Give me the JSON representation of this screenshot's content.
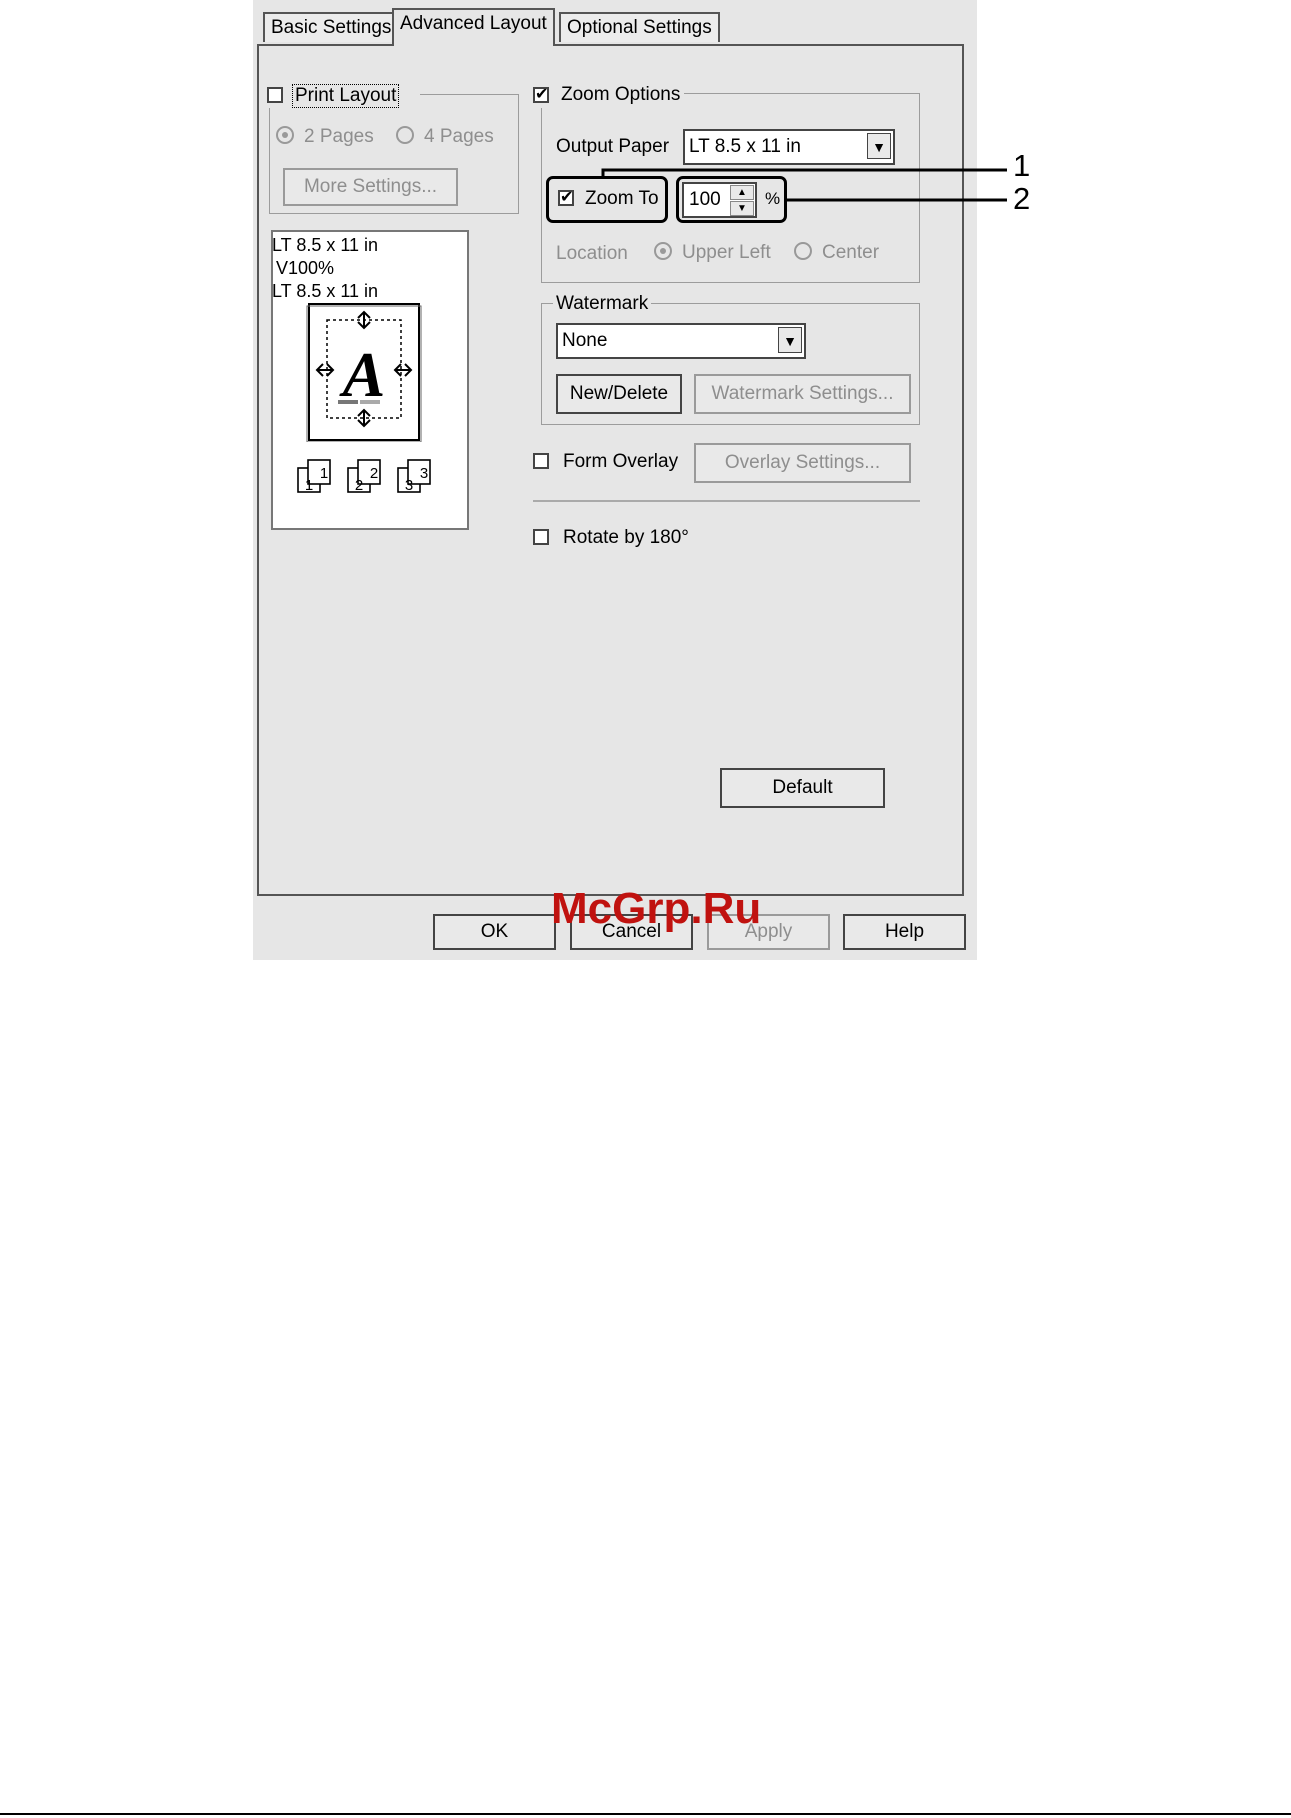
{
  "tabs": [
    {
      "label": "Basic Settings"
    },
    {
      "label": "Advanced Layout"
    },
    {
      "label": "Optional Settings"
    }
  ],
  "print_layout": {
    "label": "Print Layout",
    "checked": false,
    "options": [
      "2 Pages",
      "4 Pages"
    ],
    "more_settings": "More Settings..."
  },
  "preview": {
    "lines": [
      "LT 8.5 x 11 in",
      "V100%",
      "LT 8.5 x 11 in"
    ],
    "glyph": "A",
    "page_numbers": [
      "1",
      "2",
      "3"
    ]
  },
  "zoom_options": {
    "label": "Zoom Options",
    "checked": true,
    "output_paper_label": "Output Paper",
    "output_paper_value": "LT 8.5 x 11 in",
    "zoom_to_label": "Zoom To",
    "zoom_to_checked": true,
    "zoom_value": "100",
    "percent": "%",
    "location_label": "Location",
    "location_options": [
      "Upper Left",
      "Center"
    ]
  },
  "watermark": {
    "label": "Watermark",
    "value": "None",
    "new_delete": "New/Delete",
    "settings": "Watermark Settings..."
  },
  "form_overlay": {
    "label": "Form Overlay",
    "settings": "Overlay Settings..."
  },
  "rotate": {
    "label": "Rotate by 180°"
  },
  "buttons": {
    "default": "Default",
    "ok": "OK",
    "cancel": "Cancel",
    "apply": "Apply",
    "help": "Help"
  },
  "callouts": {
    "one": "1",
    "two": "2"
  },
  "watermark_text": "McGrp.Ru"
}
